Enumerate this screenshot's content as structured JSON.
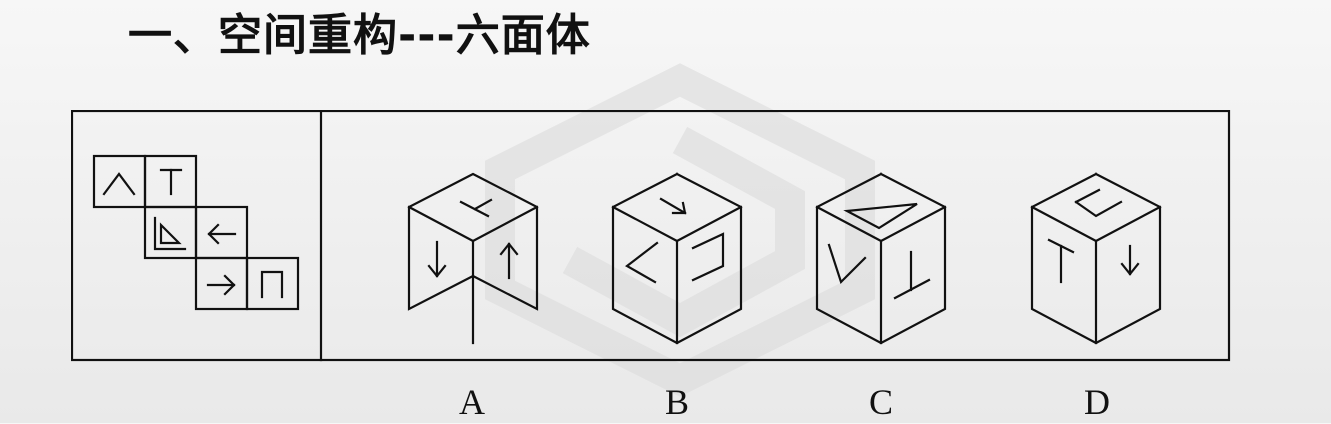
{
  "title": "一、空间重构---六面体",
  "options": [
    "A",
    "B",
    "C",
    "D"
  ]
}
